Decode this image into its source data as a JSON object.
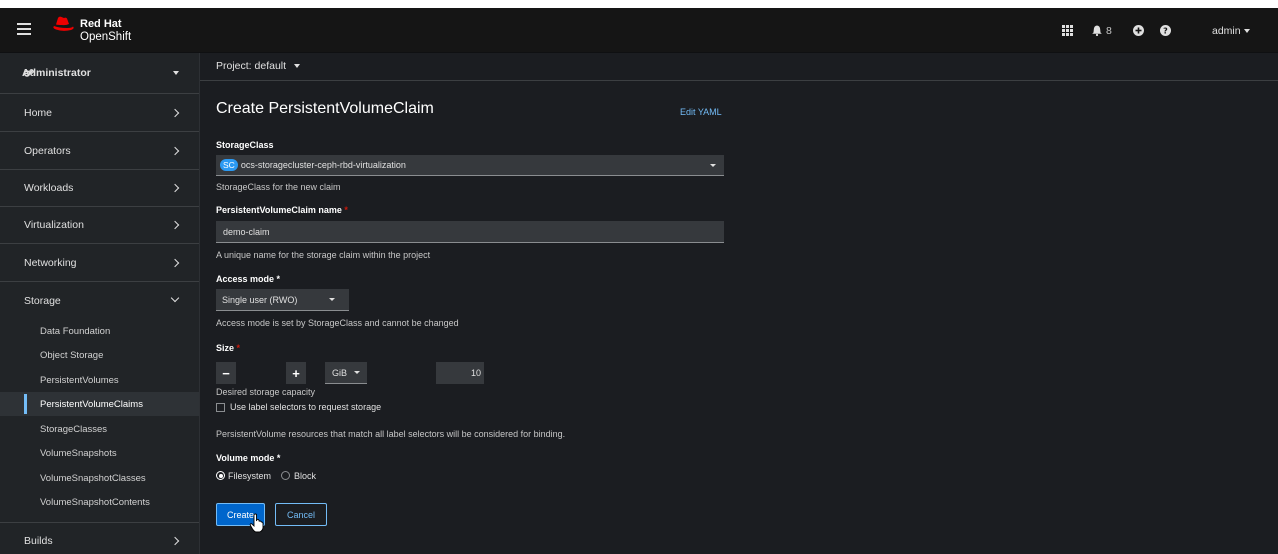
{
  "masthead": {
    "brand_line1": "Red Hat",
    "brand_line2": "OpenShift",
    "notification_count": "8",
    "user_label": "admin",
    "icons": [
      "app-launcher-icon",
      "bell-icon",
      "plus-circle-icon",
      "help-icon",
      "caret-down-icon"
    ]
  },
  "sidebar": {
    "perspective": "Administrator",
    "sections": [
      {
        "label": "Home"
      },
      {
        "label": "Operators"
      },
      {
        "label": "Workloads"
      },
      {
        "label": "Virtualization"
      },
      {
        "label": "Networking"
      },
      {
        "label": "Storage"
      },
      {
        "label": "Builds"
      }
    ],
    "storage_items": [
      {
        "label": "Data Foundation"
      },
      {
        "label": "Object Storage"
      },
      {
        "label": "PersistentVolumes"
      },
      {
        "label": "PersistentVolumeClaims"
      },
      {
        "label": "StorageClasses"
      },
      {
        "label": "VolumeSnapshots"
      },
      {
        "label": "VolumeSnapshotClasses"
      },
      {
        "label": "VolumeSnapshotContents"
      }
    ],
    "active_item": "PersistentVolumeClaims"
  },
  "project": {
    "label": "Project: default"
  },
  "form": {
    "title": "Create PersistentVolumeClaim",
    "edit_yaml": "Edit YAML",
    "storage_class": {
      "label": "StorageClass",
      "badge": "SC",
      "value": "ocs-storagecluster-ceph-rbd-virtualization",
      "help": "StorageClass for the new claim"
    },
    "pvc_name": {
      "label": "PersistentVolumeClaim name",
      "required": "*",
      "value": "demo-claim",
      "help": "A unique name for the storage claim within the project"
    },
    "access_mode": {
      "label": "Access mode",
      "required": "*",
      "value": "Single user (RWO)",
      "help": "Access mode is set by StorageClass and cannot be changed"
    },
    "size": {
      "label": "Size",
      "required": "*",
      "minus": "−",
      "value": "10",
      "plus": "+",
      "unit": "GiB",
      "help": "Desired storage capacity"
    },
    "label_selector": {
      "label": "Use label selectors to request storage",
      "checked": false,
      "help": "PersistentVolume resources that match all label selectors will be considered for binding."
    },
    "volume_mode": {
      "label": "Volume mode",
      "required": "*",
      "options": [
        "Filesystem",
        "Block"
      ],
      "selected": "Filesystem"
    },
    "create_label": "Create",
    "cancel_label": "Cancel"
  },
  "colors": {
    "masthead_bg": "#151515",
    "sidebar_bg": "#212427",
    "content_bg": "#1b1d21",
    "link": "#73bcf7",
    "primary": "#0066cc",
    "required": "#c9190b"
  }
}
